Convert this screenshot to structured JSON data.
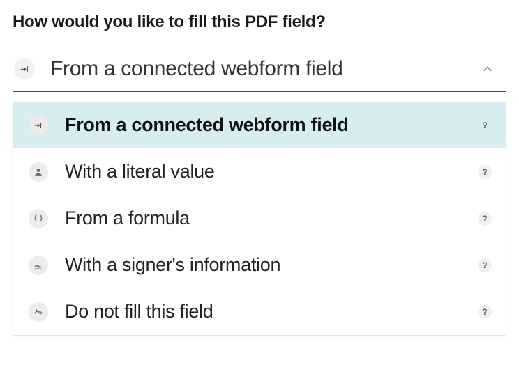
{
  "title": "How would you like to fill this PDF field?",
  "dropdown": {
    "selected_label": "From a connected webform field",
    "selected_icon": "arrow-into-icon",
    "options": [
      {
        "label": "From a connected webform field",
        "icon": "arrow-into-icon",
        "selected": true
      },
      {
        "label": "With a literal value",
        "icon": "person-icon",
        "selected": false
      },
      {
        "label": "From a formula",
        "icon": "braces-icon",
        "selected": false
      },
      {
        "label": "With a signer's information",
        "icon": "signature-icon",
        "selected": false
      },
      {
        "label": "Do not fill this field",
        "icon": "no-entry-icon",
        "selected": false
      }
    ]
  },
  "help_glyph": "?"
}
